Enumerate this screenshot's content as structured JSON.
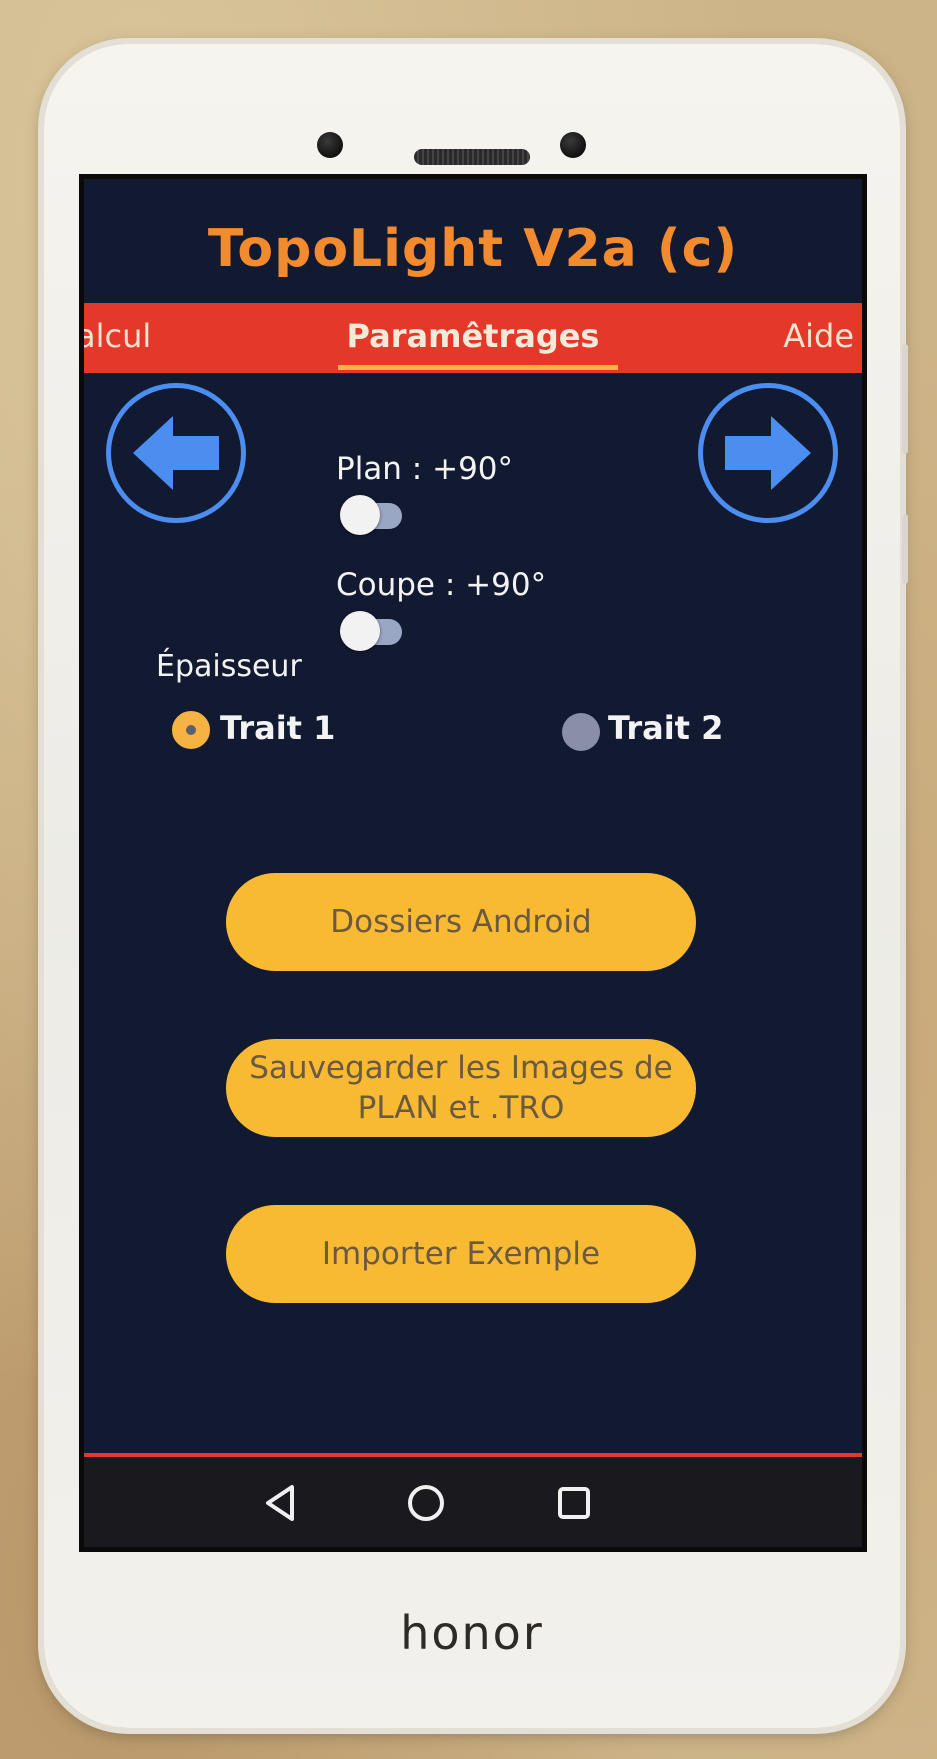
{
  "device": {
    "brand": "honor"
  },
  "app": {
    "title": "TopoLight  V2a (c)"
  },
  "tabs": {
    "left": "alcul",
    "active": "Paramêtrages",
    "right": "Aide"
  },
  "toggles": [
    {
      "label": "Plan : +90°",
      "on": false
    },
    {
      "label": "Coupe : +90°",
      "on": false
    }
  ],
  "thickness": {
    "label": "Épaisseur",
    "options": [
      {
        "label": "Trait 1",
        "selected": true
      },
      {
        "label": "Trait 2",
        "selected": false
      }
    ]
  },
  "buttons": {
    "android_folders": "Dossiers Android",
    "save_images": "Sauvegarder les Images de PLAN et .TRO",
    "import_example": "Importer Exemple"
  },
  "colors": {
    "background": "#121a32",
    "title": "#f28a2e",
    "tabbar": "#e3382a",
    "accent": "#f6b341",
    "nav_arrow": "#4b8ef0",
    "button": "#f8ba33"
  },
  "icons": {
    "prev": "arrow-left-icon",
    "next": "arrow-right-icon",
    "back": "back-triangle-icon",
    "home": "home-circle-icon",
    "recents": "recents-square-icon"
  }
}
